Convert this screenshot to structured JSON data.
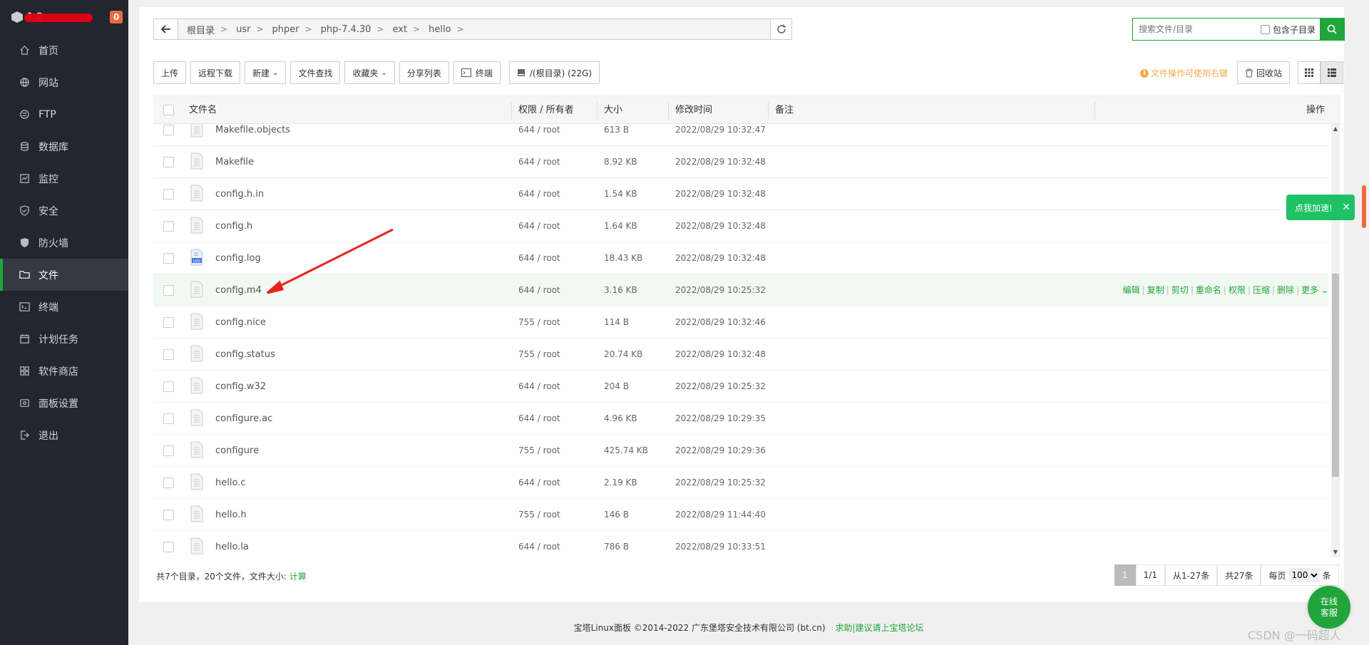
{
  "sidebar": {
    "server_name": "1.2",
    "badge": "0",
    "items": [
      {
        "label": "首页",
        "icon": "home-icon"
      },
      {
        "label": "网站",
        "icon": "globe-icon"
      },
      {
        "label": "FTP",
        "icon": "ftp-icon"
      },
      {
        "label": "数据库",
        "icon": "database-icon"
      },
      {
        "label": "监控",
        "icon": "monitor-icon"
      },
      {
        "label": "安全",
        "icon": "shield-check-icon"
      },
      {
        "label": "防火墙",
        "icon": "firewall-icon"
      },
      {
        "label": "文件",
        "icon": "folder-icon",
        "active": true
      },
      {
        "label": "终端",
        "icon": "terminal-icon"
      },
      {
        "label": "计划任务",
        "icon": "calendar-icon"
      },
      {
        "label": "软件商店",
        "icon": "apps-icon"
      },
      {
        "label": "面板设置",
        "icon": "gear-icon"
      },
      {
        "label": "退出",
        "icon": "logout-icon"
      }
    ]
  },
  "path": {
    "crumbs": [
      "根目录",
      "usr",
      "phper",
      "php-7.4.30",
      "ext",
      "hello"
    ]
  },
  "search": {
    "placeholder": "搜索文件/目录",
    "include_sub": "包含子目录"
  },
  "toolbar": {
    "upload": "上传",
    "remote_download": "远程下载",
    "new": "新建",
    "file_search": "文件查找",
    "favorites": "收藏夹",
    "share_list": "分享列表",
    "terminal": "终端",
    "disk": "/(根目录) (22G)",
    "tip": "文件操作可使用右键",
    "recycle": "回收站"
  },
  "table": {
    "headers": {
      "name": "文件名",
      "perm": "权限 / 所有者",
      "size": "大小",
      "mtime": "修改时间",
      "note": "备注",
      "ops": "操作"
    },
    "rows": [
      {
        "name": "Makefile.objects",
        "perm": "644 / root",
        "size": "613 B",
        "mtime": "2022/08/29 10:32:47"
      },
      {
        "name": "Makefile",
        "perm": "644 / root",
        "size": "8.92 KB",
        "mtime": "2022/08/29 10:32:48"
      },
      {
        "name": "config.h.in",
        "perm": "644 / root",
        "size": "1.54 KB",
        "mtime": "2022/08/29 10:32:48"
      },
      {
        "name": "config.h",
        "perm": "644 / root",
        "size": "1.64 KB",
        "mtime": "2022/08/29 10:32:48"
      },
      {
        "name": "config.log",
        "perm": "644 / root",
        "size": "18.43 KB",
        "mtime": "2022/08/29 10:32:48",
        "type": "log"
      },
      {
        "name": "config.m4",
        "perm": "644 / root",
        "size": "3.16 KB",
        "mtime": "2022/08/29 10:25:32",
        "hover": true
      },
      {
        "name": "config.nice",
        "perm": "755 / root",
        "size": "114 B",
        "mtime": "2022/08/29 10:32:46"
      },
      {
        "name": "config.status",
        "perm": "755 / root",
        "size": "20.74 KB",
        "mtime": "2022/08/29 10:32:48"
      },
      {
        "name": "config.w32",
        "perm": "644 / root",
        "size": "204 B",
        "mtime": "2022/08/29 10:25:32"
      },
      {
        "name": "configure.ac",
        "perm": "644 / root",
        "size": "4.96 KB",
        "mtime": "2022/08/29 10:29:35"
      },
      {
        "name": "configure",
        "perm": "755 / root",
        "size": "425.74 KB",
        "mtime": "2022/08/29 10:29:36"
      },
      {
        "name": "hello.c",
        "perm": "644 / root",
        "size": "2.19 KB",
        "mtime": "2022/08/29 10:25:32"
      },
      {
        "name": "hello.h",
        "perm": "755 / root",
        "size": "146 B",
        "mtime": "2022/08/29 11:44:40"
      },
      {
        "name": "hello.la",
        "perm": "644 / root",
        "size": "786 B",
        "mtime": "2022/08/29 10:33:51"
      }
    ],
    "row_ops": [
      "编辑",
      "复制",
      "剪切",
      "重命名",
      "权限",
      "压缩",
      "删除",
      "更多"
    ]
  },
  "footer": {
    "stat": "共7个目录，20个文件，文件大小:",
    "calc": "计算",
    "page_current": "1",
    "page_total": "1/1",
    "range": "从1-27条",
    "total": "共27条",
    "per_page_label": "每页",
    "per_page_value": "100",
    "per_page_unit": "条"
  },
  "copyright": {
    "text": "宝塔Linux面板 ©2014-2022 广东堡塔安全技术有限公司 (bt.cn)",
    "help": "求助|建议请上宝塔论坛"
  },
  "float": {
    "accel": "点我加速!",
    "online_1": "在线",
    "online_2": "客服",
    "watermark": "CSDN @一码超人"
  },
  "colors": {
    "accent": "#20a53a",
    "sidebar_bg": "#23262e",
    "annotation_arrow": "#e8231a"
  }
}
